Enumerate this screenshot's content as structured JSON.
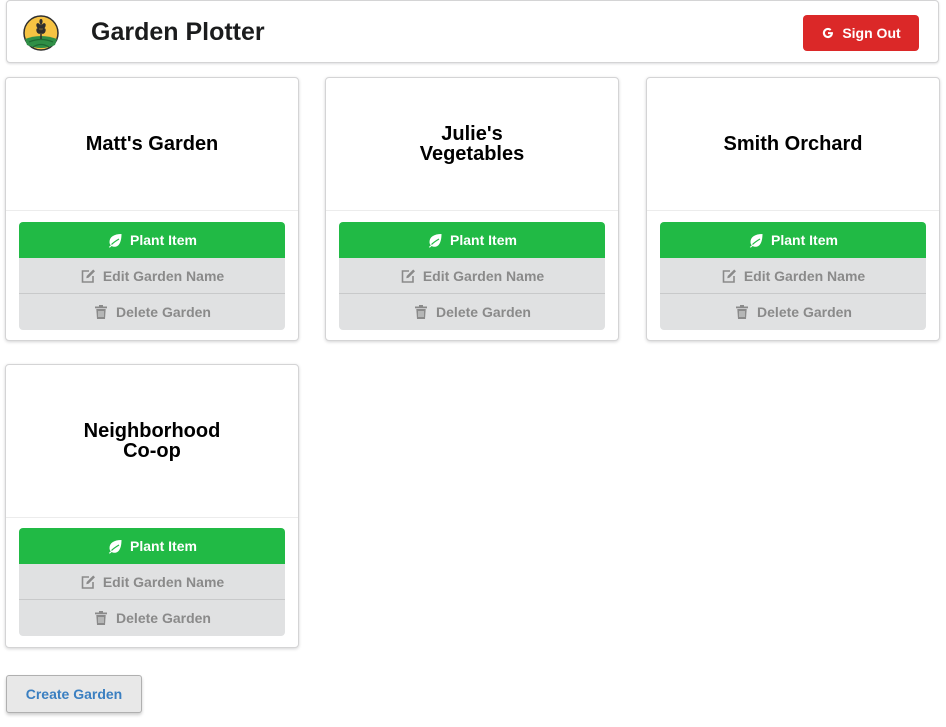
{
  "header": {
    "title": "Garden Plotter",
    "logo_icon": "wheat-field-logo-icon",
    "sign_out_label": "Sign Out",
    "sign_out_icon": "google-icon",
    "sign_out_color": "#db2828"
  },
  "gardens": [
    {
      "name": "Matt's Garden",
      "plant_label": "Plant Item",
      "edit_label": "Edit Garden Name",
      "delete_label": "Delete Garden"
    },
    {
      "name": "Julie's Vegetables",
      "plant_label": "Plant Item",
      "edit_label": "Edit Garden Name",
      "delete_label": "Delete Garden"
    },
    {
      "name": "Smith Orchard",
      "plant_label": "Plant Item",
      "edit_label": "Edit Garden Name",
      "delete_label": "Delete Garden"
    },
    {
      "name": "Neighborhood Co-op",
      "plant_label": "Plant Item",
      "edit_label": "Edit Garden Name",
      "delete_label": "Delete Garden"
    }
  ],
  "icons": {
    "plant": "leaf-icon",
    "edit": "edit-icon",
    "delete": "trash-icon"
  },
  "colors": {
    "plant": "#21ba45",
    "secondary": "#e0e1e2",
    "create_text": "#3a7fc1"
  },
  "create_label": "Create Garden"
}
